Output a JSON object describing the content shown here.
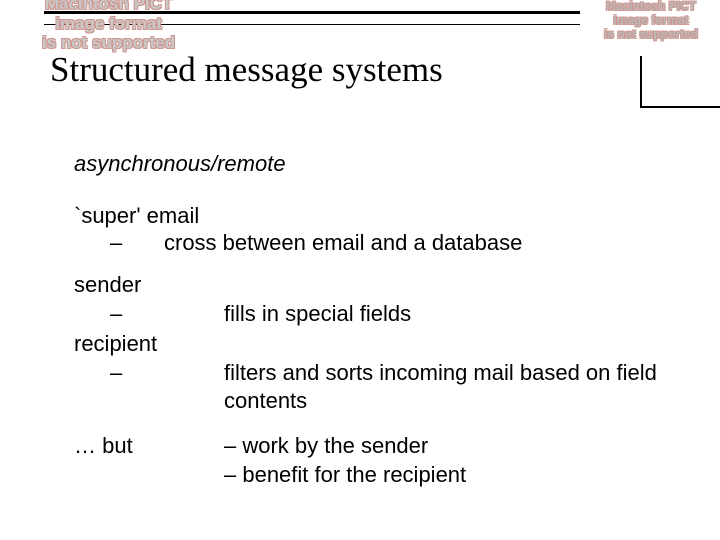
{
  "badge": {
    "line1": "Macintosh PICT",
    "line2": "image format",
    "line3": "is not supported"
  },
  "title": "Structured message systems",
  "subtitle": "asynchronous/remote",
  "super": {
    "label": "`super' email",
    "dash": "–",
    "text": "cross between email and a database"
  },
  "sender": {
    "label": "sender",
    "dash": "–",
    "text": "fills in special fields"
  },
  "recipient": {
    "label": "recipient",
    "dash": "–",
    "text": "filters and sorts incoming mail based on field contents"
  },
  "but": {
    "label": "… but",
    "line1": "–  work by the sender",
    "line2": "–  benefit for the recipient"
  }
}
